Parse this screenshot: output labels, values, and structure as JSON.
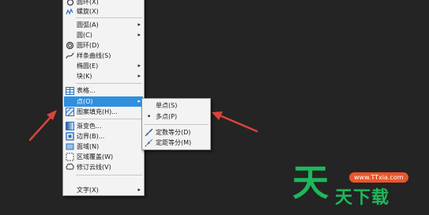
{
  "main_menu": {
    "items": [
      {
        "label": "圆环(X)",
        "icon": "ring-icon"
      },
      {
        "label": "螺旋(X)",
        "icon": "helix-icon"
      },
      {
        "label": "圆弧(A)",
        "arrow": "▸"
      },
      {
        "label": "圆(C)",
        "arrow": "▸"
      },
      {
        "label": "圆环(D)",
        "icon": "donut-icon"
      },
      {
        "label": "样条曲线(S)",
        "icon": "spline-icon"
      },
      {
        "label": "椭圆(E)",
        "arrow": "▸"
      },
      {
        "label": "块(K)",
        "arrow": "▸"
      },
      {
        "label": "表格...",
        "icon": "table-icon"
      },
      {
        "label": "点(O)",
        "arrow": "▸"
      },
      {
        "label": "图案填充(H)...",
        "icon": "hatch-icon"
      },
      {
        "label": "渐变色...",
        "icon": "gradient-icon"
      },
      {
        "label": "边界(B)...",
        "icon": "boundary-icon"
      },
      {
        "label": "面域(N)",
        "icon": "region-icon"
      },
      {
        "label": "区域覆盖(W)",
        "icon": "wipeout-icon"
      },
      {
        "label": "修订云线(V)",
        "icon": "revcloud-icon"
      },
      {
        "label": "文字(X)",
        "arrow": "▸"
      }
    ]
  },
  "sub_menu": {
    "items": [
      {
        "label": "单点(S)"
      },
      {
        "label": "多点(P)",
        "bullet": "•"
      },
      {
        "label": "定数等分(D)",
        "icon": "divide-icon"
      },
      {
        "label": "定距等分(M)",
        "icon": "measure-icon"
      }
    ]
  },
  "watermark": {
    "big": "天",
    "sub": "天下载",
    "url": "www.TTxia.com"
  },
  "colors": {
    "highlight": "#2f8fdd",
    "arrow": "#d9433a",
    "watermark_green": "#1eb85a",
    "url_badge": "#e8562a"
  }
}
